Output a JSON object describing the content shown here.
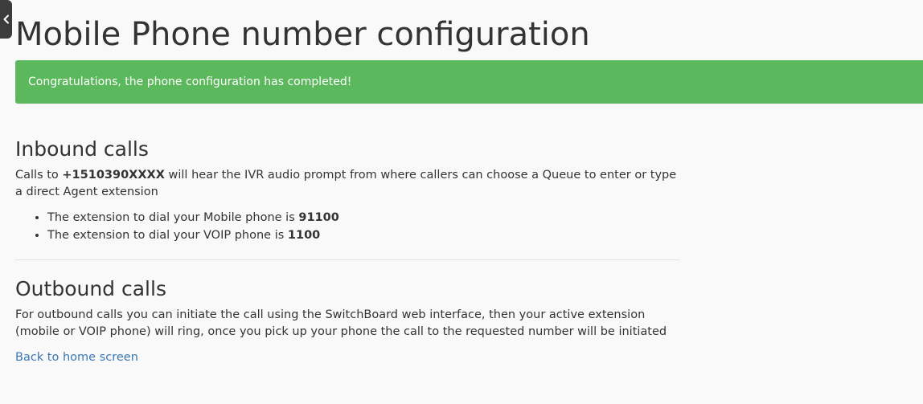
{
  "page": {
    "title": "Mobile Phone number configuration"
  },
  "alert": {
    "message": "Congratulations, the phone configuration has completed!",
    "color": "#5cb85c"
  },
  "inbound": {
    "heading": "Inbound calls",
    "desc_prefix": "Calls to ",
    "phone_number": "+1510390XXXX",
    "desc_suffix": " will hear the IVR audio prompt from where callers can choose a Queue to enter or type a direct Agent extension",
    "items": [
      {
        "text": "The extension to dial your Mobile phone is ",
        "value": "91100"
      },
      {
        "text": "The extension to dial your VOIP phone is ",
        "value": "1100"
      }
    ]
  },
  "outbound": {
    "heading": "Outbound calls",
    "desc": "For outbound calls you can initiate the call using the SwitchBoard web interface, then your active extension (mobile or VOIP phone) will ring, once you pick up your phone the call to the requested number will be initiated"
  },
  "links": {
    "home": "Back to home screen"
  },
  "icons": {
    "sidebar_toggle": "chevron-left-icon"
  },
  "colors": {
    "link": "#3a77b4",
    "text": "#333333",
    "handle": "#3c3c3c"
  }
}
